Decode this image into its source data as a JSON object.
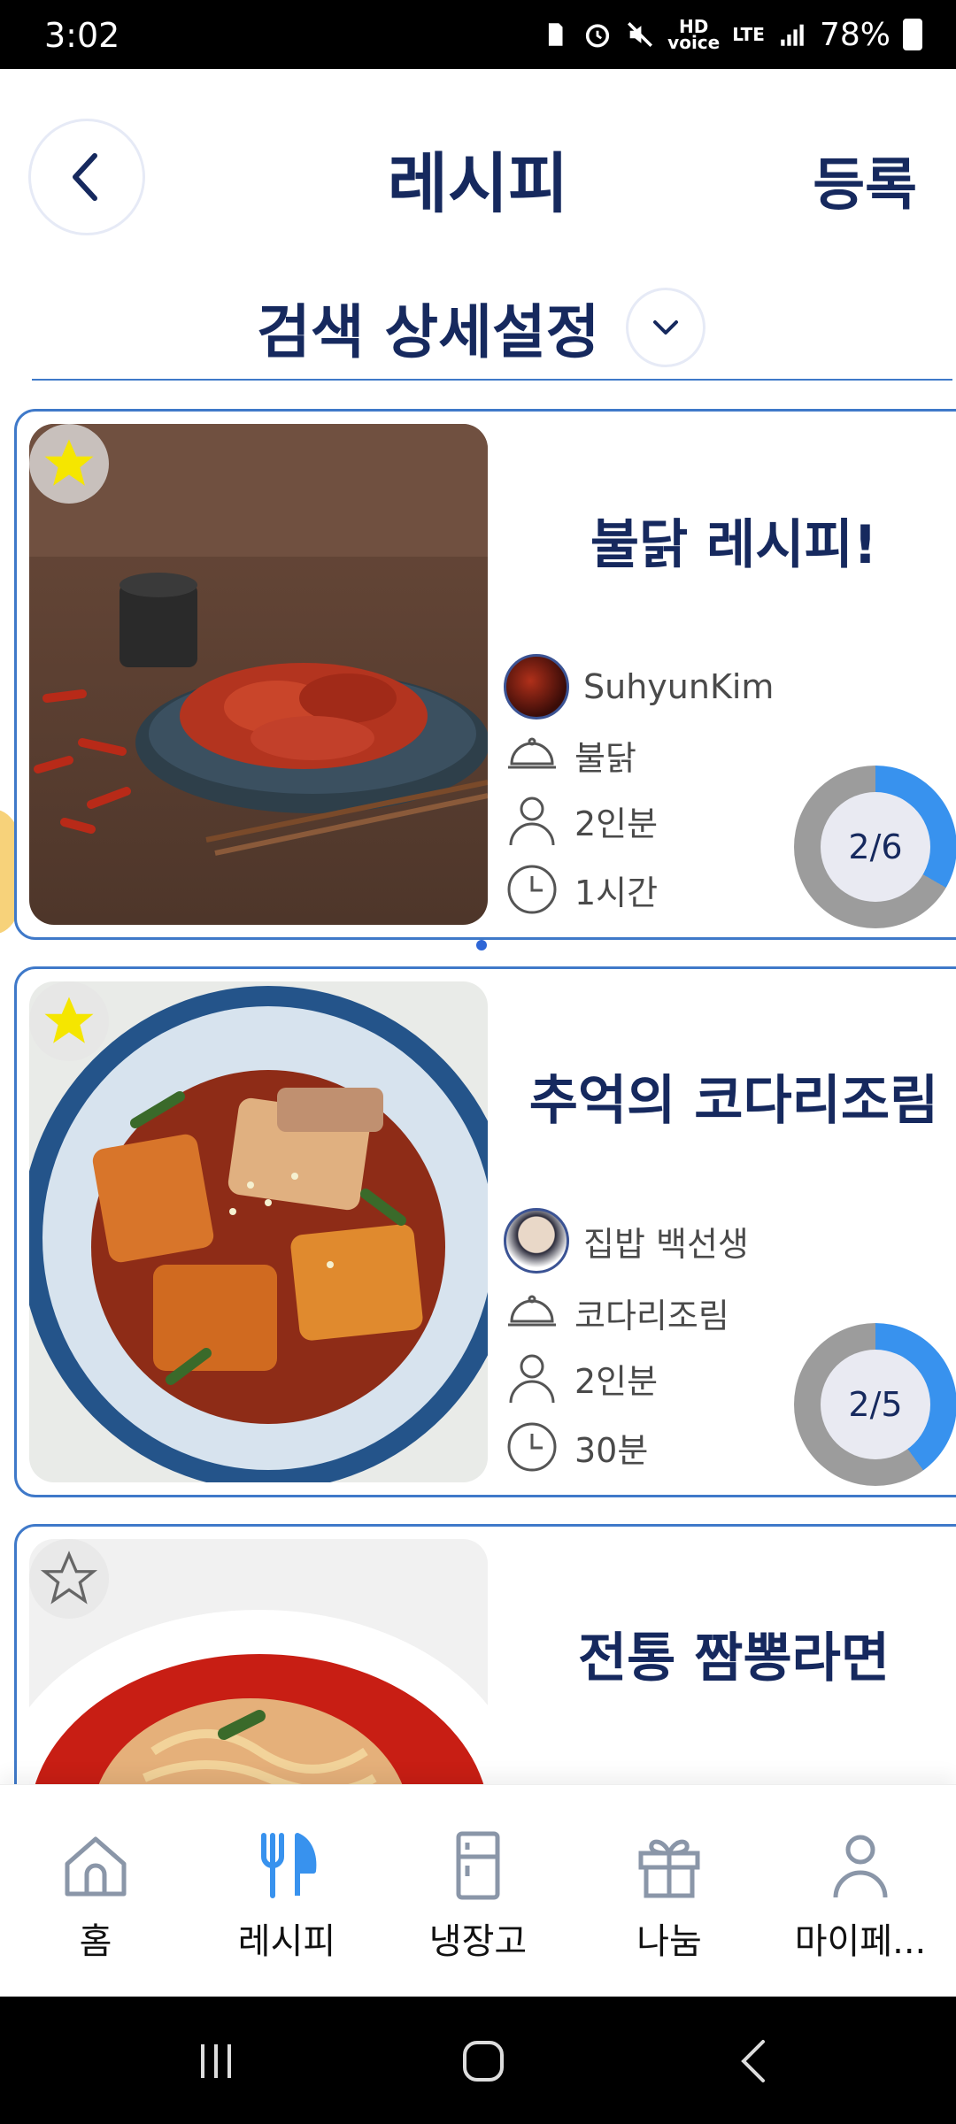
{
  "status_bar": {
    "time": "3:02",
    "network": "LTE",
    "battery": "78%"
  },
  "header": {
    "title": "레시피",
    "register_label": "등록",
    "back_icon": "chevron-left-icon"
  },
  "search": {
    "settings_label": "검색 상세설정",
    "toggle_icon": "chevron-down-icon"
  },
  "recipes": [
    {
      "title": "불닭 레시피!",
      "author": "SuhyunKim",
      "dish": "불닭",
      "servings": "2인분",
      "time": "1시간",
      "progress_text": "2/6",
      "progress_fraction": 0.333,
      "favorite": true
    },
    {
      "title": "추억의 코다리조림",
      "author": "집밥 백선생",
      "dish": "코다리조림",
      "servings": "2인분",
      "time": "30분",
      "progress_text": "2/5",
      "progress_fraction": 0.4,
      "favorite": true
    },
    {
      "title": "전통 짬뽕라면",
      "favorite": false
    }
  ],
  "bottom_nav": {
    "items": [
      {
        "label": "홈",
        "icon": "home-icon"
      },
      {
        "label": "레시피",
        "icon": "fork-knife-icon",
        "active": true
      },
      {
        "label": "냉장고",
        "icon": "fridge-icon"
      },
      {
        "label": "나눔",
        "icon": "gift-icon"
      },
      {
        "label": "마이페...",
        "icon": "person-icon"
      }
    ]
  },
  "colors": {
    "primary": "#16295e",
    "accent": "#3892ee",
    "card_border": "#3f79c9",
    "star": "#f5e600"
  }
}
